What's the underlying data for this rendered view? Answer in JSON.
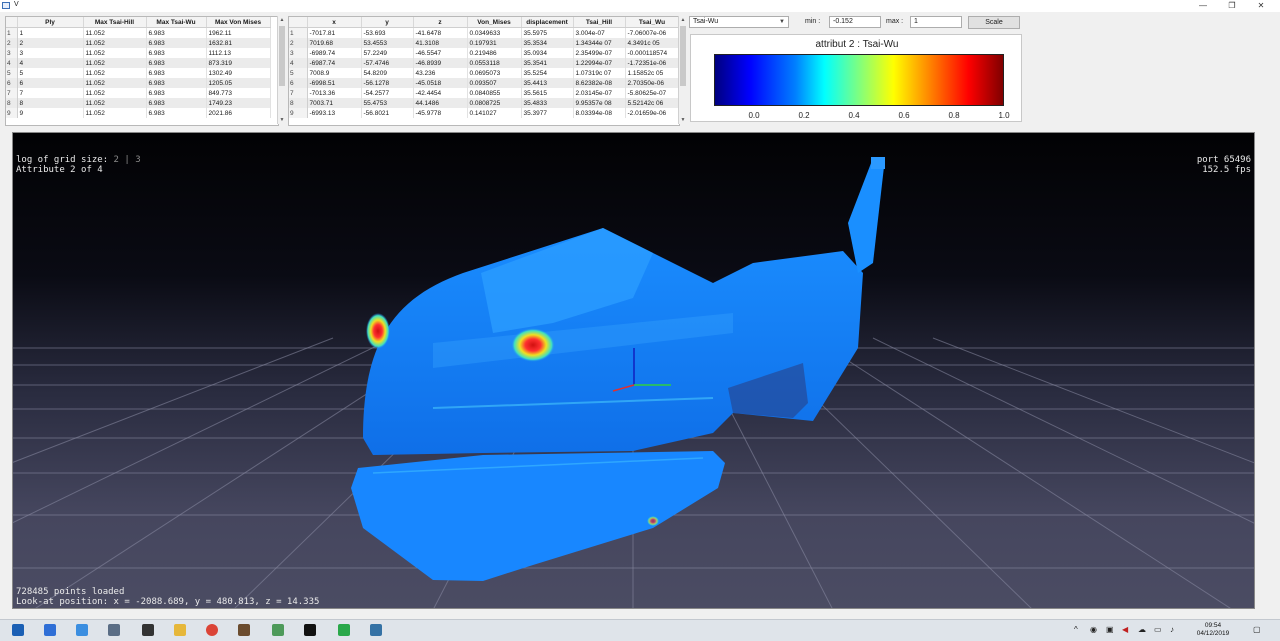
{
  "window": {
    "title": "V",
    "minimize": "—",
    "maximize": "❐",
    "close": "✕"
  },
  "ply_table": {
    "headers": [
      "",
      "Ply",
      "Max Tsai-Hill",
      "Max Tsai-Wu",
      "Max Von Mises"
    ],
    "rows": [
      [
        "1",
        "1",
        "11.052",
        "6.983",
        "1962.11"
      ],
      [
        "2",
        "2",
        "11.052",
        "6.983",
        "1632.81"
      ],
      [
        "3",
        "3",
        "11.052",
        "6.983",
        "1112.13"
      ],
      [
        "4",
        "4",
        "11.052",
        "6.983",
        "873.319"
      ],
      [
        "5",
        "5",
        "11.052",
        "6.983",
        "1302.49"
      ],
      [
        "6",
        "6",
        "11.052",
        "6.983",
        "1205.05"
      ],
      [
        "7",
        "7",
        "11.052",
        "6.983",
        "849.773"
      ],
      [
        "8",
        "8",
        "11.052",
        "6.983",
        "1749.23"
      ],
      [
        "9",
        "9",
        "11.052",
        "6.983",
        "2021.86"
      ]
    ]
  },
  "points_table": {
    "headers": [
      "",
      "x",
      "y",
      "z",
      "Von_Mises",
      "displacement",
      "Tsai_Hill",
      "Tsai_Wu"
    ],
    "rows": [
      [
        "1",
        "-7017.81",
        "-53.693",
        "-41.6478",
        "0.0349633",
        "35.5975",
        "3.004e-07",
        "-7.06007e-06"
      ],
      [
        "2",
        "7019.68",
        "53.4553",
        "41.3108",
        "0.197931",
        "35.3534",
        "1.34344e 07",
        "4.3491c 05"
      ],
      [
        "3",
        "-6989.74",
        "57.2249",
        "-46.5547",
        "0.219486",
        "35.0934",
        "2.35499e-07",
        "-0.000118574"
      ],
      [
        "4",
        "-6987.74",
        "-57.4746",
        "-46.8939",
        "0.0553118",
        "35.3541",
        "1.22994e-07",
        "-1.72351e-06"
      ],
      [
        "5",
        "7008.9",
        "54.8209",
        "43.236",
        "0.0695073",
        "35.5254",
        "1.07319c 07",
        "1.15852c 05"
      ],
      [
        "6",
        "-6998.51",
        "-56.1278",
        "-45.0518",
        "0.093507",
        "35.4413",
        "8.62382e-08",
        "2.70350e-06"
      ],
      [
        "7",
        "-7013.36",
        "-54.2577",
        "-42.4454",
        "0.0840855",
        "35.5615",
        "2.03145e-07",
        "-5.80625e-07"
      ],
      [
        "8",
        "7003.71",
        "55.4753",
        "44.1486",
        "0.0808725",
        "35.4833",
        "9.95357e 08",
        "5.52142c 06"
      ],
      [
        "9",
        "-6993.13",
        "-56.8021",
        "-45.9778",
        "0.141027",
        "35.3977",
        "8.03394e-08",
        "-2.01659e-06"
      ]
    ]
  },
  "controls": {
    "attribute_select": "Tsai-Wu",
    "min_label": "min :",
    "min_value": "-0.152",
    "max_label": "max :",
    "max_value": "1",
    "scale_button": "Scale"
  },
  "legend": {
    "title": "attribut 2 : Tsai-Wu",
    "ticks": [
      "0.0",
      "0.2",
      "0.4",
      "0.6",
      "0.8",
      "1.0"
    ]
  },
  "viewer": {
    "grid_line_label": "log of grid size:",
    "grid_values": "2 | 3",
    "attribute_line": "Attribute 2 of 4",
    "port": "port 65496",
    "fps": "152.5 fps",
    "points_loaded": "728485 points loaded",
    "look_at": "Look-at position: x = -2088.689, y = 480.813, z = 14.335"
  },
  "taskbar": {
    "time": "09:54",
    "date": "04/12/2019",
    "apps": [
      "start-icon",
      "explorer-icon",
      "mail-icon",
      "files-icon",
      "settings-icon",
      "folder-icon",
      "chrome-icon",
      "paint-icon",
      "image-icon",
      "terminal-icon",
      "pycharm-icon",
      "python-icon"
    ]
  }
}
